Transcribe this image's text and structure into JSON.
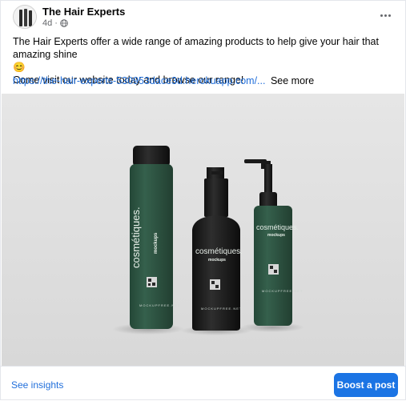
{
  "post": {
    "page_name": "The Hair Experts",
    "time": "4d",
    "separator": "·",
    "audience_icon": "globe-icon",
    "more_icon": "more-dots-icon",
    "text_line1": "The Hair Experts offer a wide range of amazing products to help give your hair that amazing shine",
    "emoji": "😊",
    "text_line2": "Come visit our website today and browse our range!",
    "link": "https://the-hair-experts-530953dace3d.herokuapp.com/...",
    "see_more": "See more"
  },
  "image": {
    "bottle_brand": "cosmétiques.",
    "bottle_sub": "mockups",
    "bottle_small_text": "MOCKUPFREE.NET",
    "colors": {
      "bottle": "#2f5845",
      "cap": "#1c1c1c",
      "background": "#e0e0e0"
    }
  },
  "footer": {
    "insights_label": "See insights",
    "boost_label": "Boost a post"
  }
}
